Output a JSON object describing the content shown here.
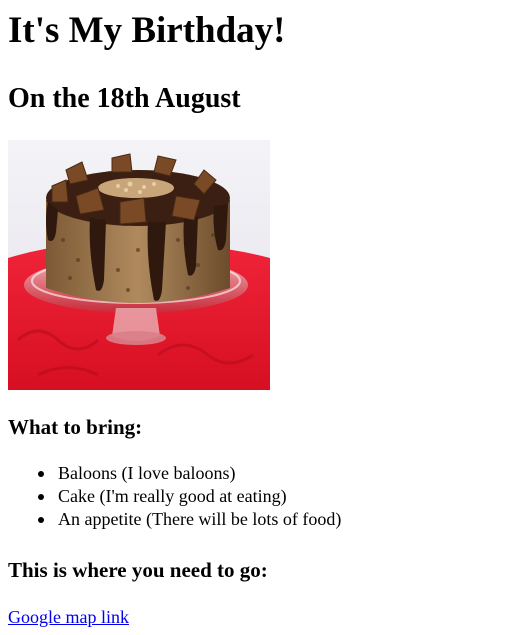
{
  "page": {
    "title": "It's My Birthday!",
    "subtitle": "On the 18th August",
    "image": {
      "subject": "chocolate-drizzled birthday cake on a glass stand over a red tablecloth"
    },
    "bring": {
      "heading": "What to bring:",
      "items": [
        "Baloons (I love baloons)",
        "Cake (I'm really good at eating)",
        "An appetite (There will be lots of food)"
      ]
    },
    "directions": {
      "heading": "This is where you need to go:",
      "link_label": "Google map link"
    }
  },
  "colors": {
    "link": "#0000ee",
    "text": "#000000",
    "background": "#ffffff",
    "tablecloth": "#e8182a",
    "chocolate": "#3b1f12",
    "sponge": "#9c7a52"
  }
}
